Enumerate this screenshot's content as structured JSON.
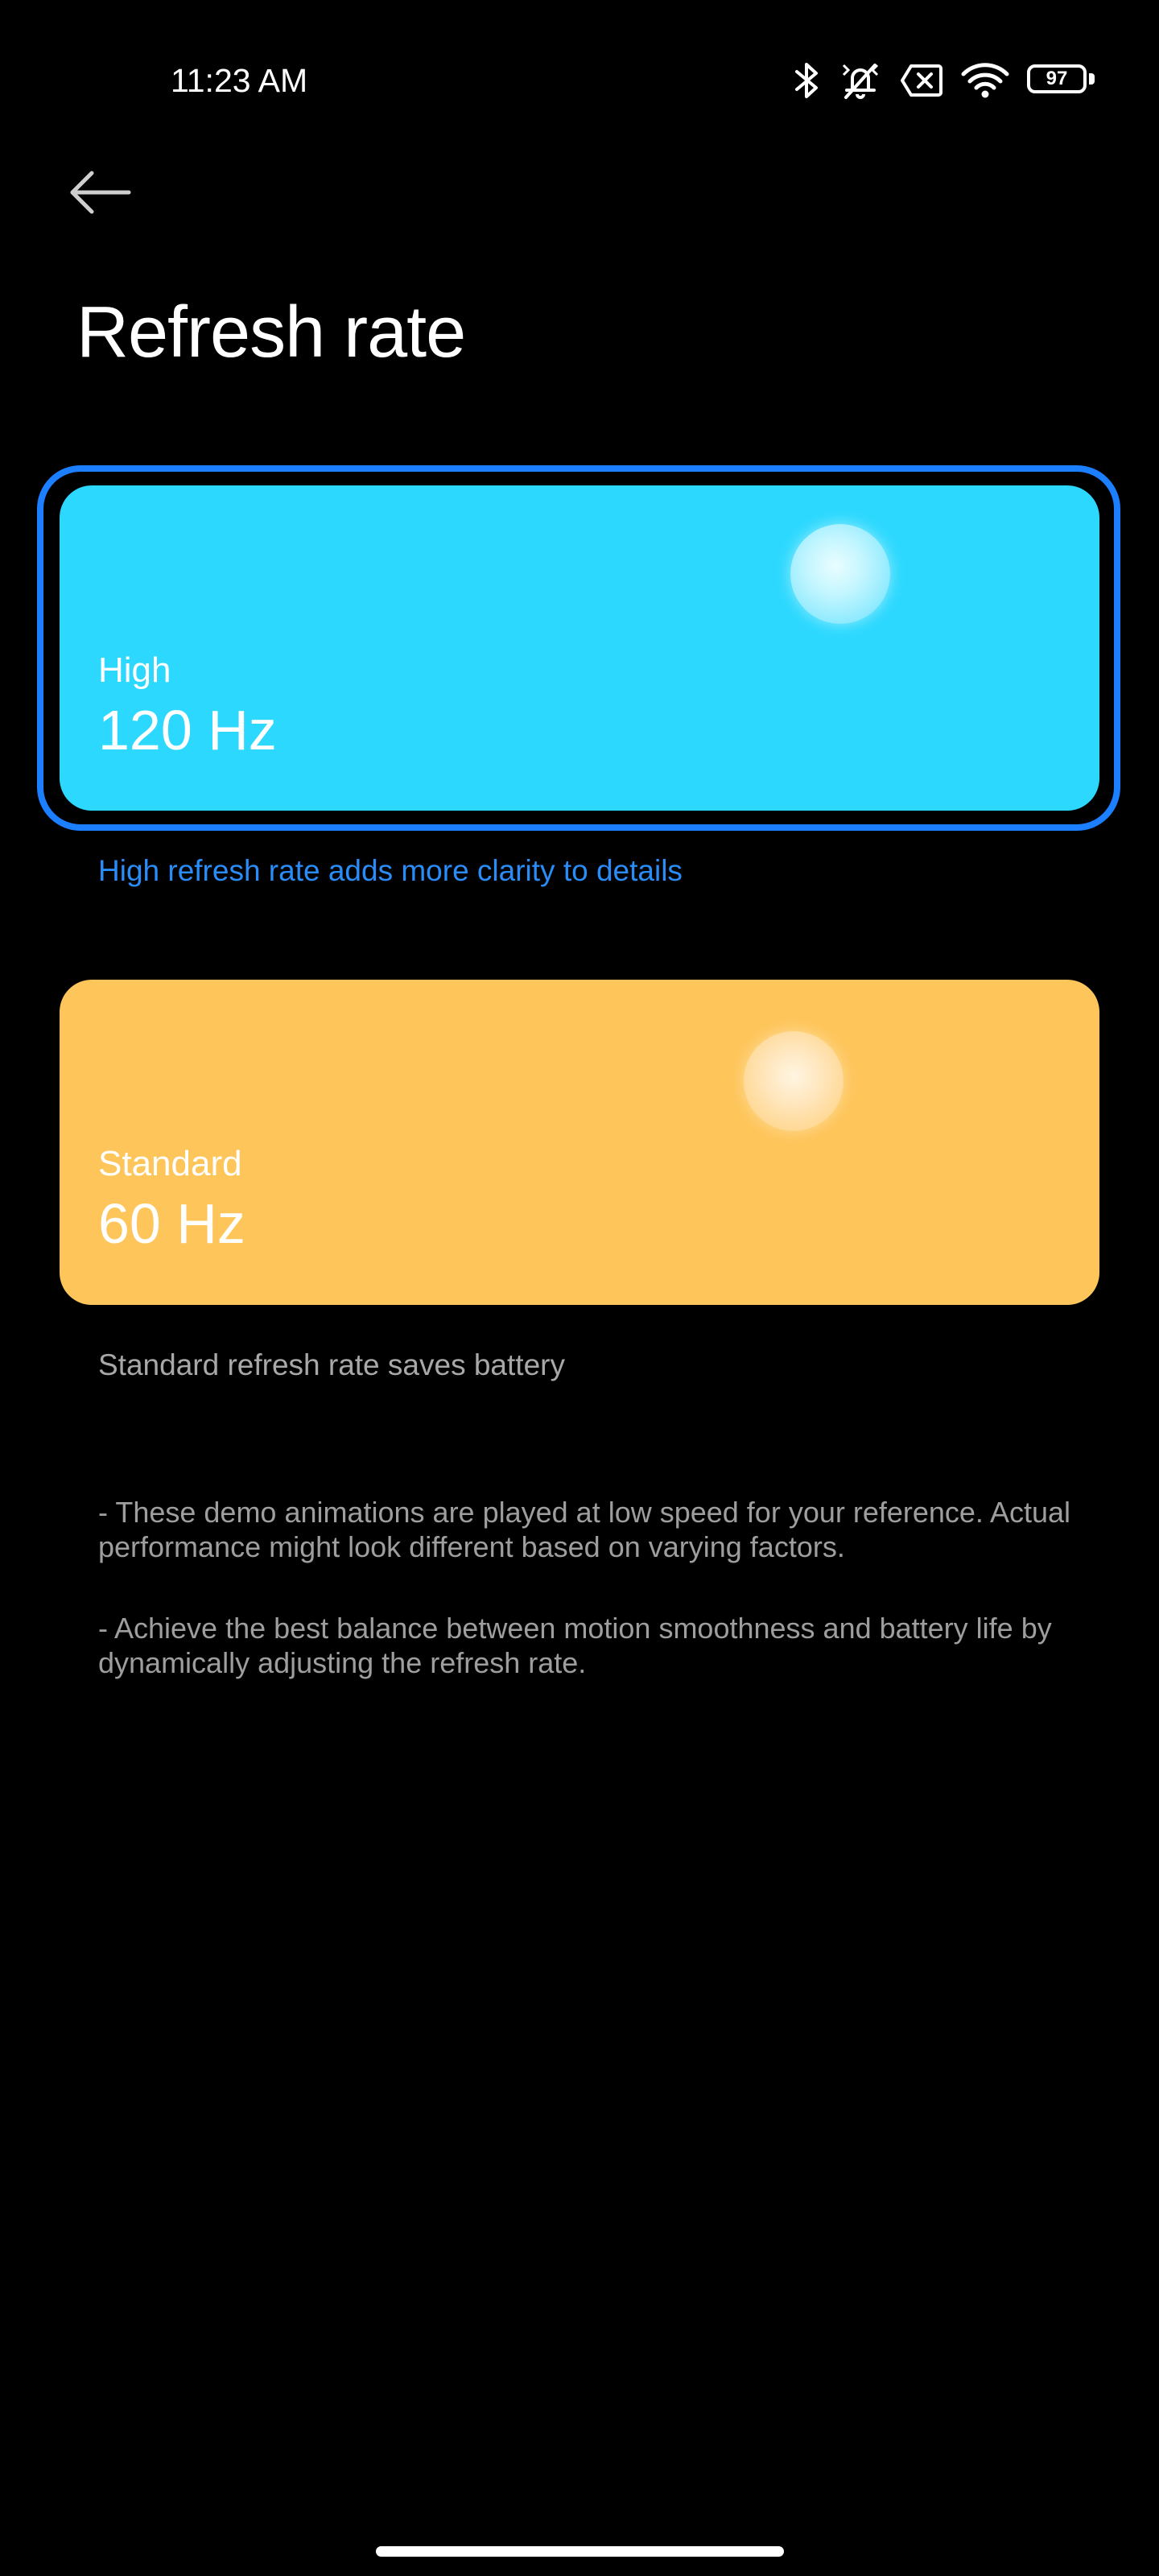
{
  "status_bar": {
    "time": "11:23 AM",
    "icons": [
      "bluetooth-icon",
      "silent-icon",
      "no-sim-icon",
      "wifi-icon",
      "battery-icon"
    ],
    "battery_level": "97"
  },
  "header": {
    "back_icon": "arrow-left-icon",
    "title": "Refresh rate"
  },
  "options": [
    {
      "label": "High",
      "value": "120 Hz",
      "description": "High refresh rate adds more clarity to details",
      "selected": true,
      "color": "#2cd8fe"
    },
    {
      "label": "Standard",
      "value": "60 Hz",
      "description": "Standard refresh rate saves battery",
      "selected": false,
      "color": "#fec55a"
    }
  ],
  "notes": [
    "- These demo animations are played at low speed for your reference. Actual performance might look different based on varying factors.",
    "- Achieve the best balance between motion smoothness and battery life by dynamically adjusting the refresh rate."
  ],
  "colors": {
    "accent": "#1b7fff",
    "selected_description": "#2a8cf6",
    "background": "#000000"
  }
}
